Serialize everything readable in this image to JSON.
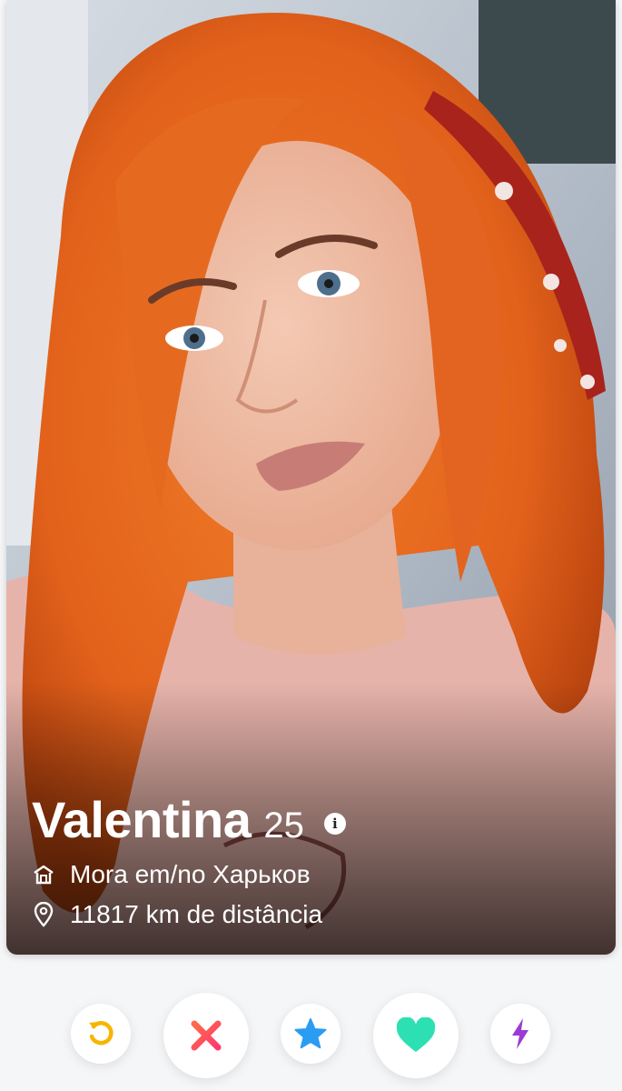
{
  "profile": {
    "name": "Valentina",
    "age": "25",
    "info_icon": "i",
    "lives_in": "Mora em/no Харьков",
    "distance": "11817 km de distância"
  },
  "photo": {
    "hair_color": "#e96b1f",
    "bandana_color": "#a8231c",
    "shirt_color": "#e6b3aa"
  },
  "actions": [
    {
      "name": "rewind",
      "icon": "rewind-icon",
      "color": "#f7b500"
    },
    {
      "name": "nope",
      "icon": "close-icon",
      "color": "#fd4b5b"
    },
    {
      "name": "super-like",
      "icon": "star-icon",
      "color": "#2a9cf2"
    },
    {
      "name": "like",
      "icon": "heart-icon",
      "color": "#2ce0b3"
    },
    {
      "name": "boost",
      "icon": "lightning-icon",
      "color": "#9b3ad4"
    }
  ]
}
